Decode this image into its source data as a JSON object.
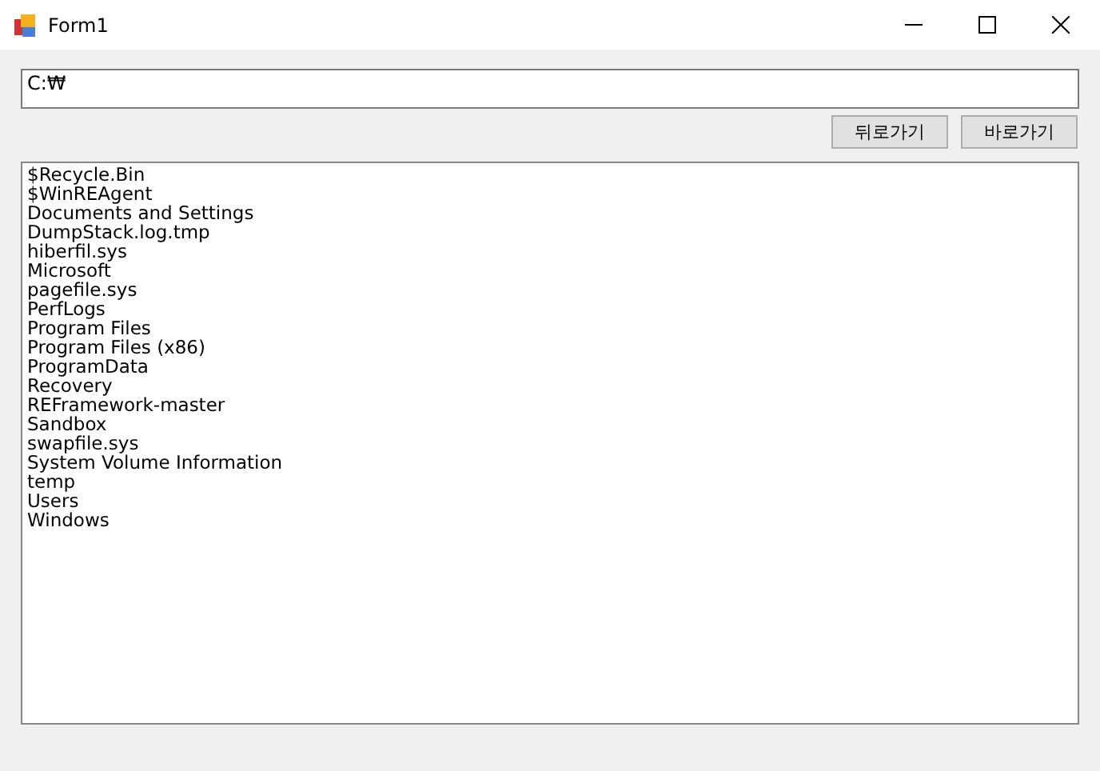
{
  "window": {
    "title": "Form1"
  },
  "path_field": {
    "value": "C:₩"
  },
  "buttons": [
    "뒤로가기",
    "바로가기"
  ],
  "list": {
    "items": [
      "$Recycle.Bin",
      "$WinREAgent",
      "Documents and Settings",
      "DumpStack.log.tmp",
      "hiberfil.sys",
      "Microsoft",
      "pagefile.sys",
      "PerfLogs",
      "Program Files",
      "Program Files (x86)",
      "ProgramData",
      "Recovery",
      "REFramework-master",
      "Sandbox",
      "swapfile.sys",
      "System Volume Information",
      "temp",
      "Users",
      "Windows"
    ]
  }
}
